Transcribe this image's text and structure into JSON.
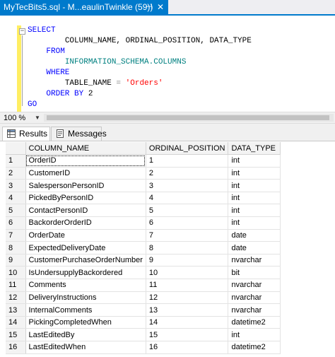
{
  "tab": {
    "title": "MyTecBits5.sql - M...eaulinTwinkle (59))",
    "pin": "⊣",
    "close": "✕"
  },
  "editor": {
    "collapse_glyph": "−",
    "line1_kw": "SELECT",
    "line2": "COLUMN_NAME, ORDINAL_POSITION, DATA_TYPE",
    "line3_kw": "FROM",
    "line4": "INFORMATION_SCHEMA.COLUMNS",
    "line5_kw": "WHERE",
    "line6_a": "TABLE_NAME",
    "line6_op": " = ",
    "line6_str": "'Orders'",
    "line7_kw": "ORDER BY",
    "line7_num": " 2",
    "go": "GO"
  },
  "zoom": {
    "value": "100 %",
    "arrow": "▼"
  },
  "result_tabs": {
    "results": "Results",
    "messages": "Messages"
  },
  "grid": {
    "columns": [
      "",
      "COLUMN_NAME",
      "ORDINAL_POSITION",
      "DATA_TYPE"
    ],
    "rows": [
      [
        "1",
        "OrderID",
        "1",
        "int"
      ],
      [
        "2",
        "CustomerID",
        "2",
        "int"
      ],
      [
        "3",
        "SalespersonPersonID",
        "3",
        "int"
      ],
      [
        "4",
        "PickedByPersonID",
        "4",
        "int"
      ],
      [
        "5",
        "ContactPersonID",
        "5",
        "int"
      ],
      [
        "6",
        "BackorderOrderID",
        "6",
        "int"
      ],
      [
        "7",
        "OrderDate",
        "7",
        "date"
      ],
      [
        "8",
        "ExpectedDeliveryDate",
        "8",
        "date"
      ],
      [
        "9",
        "CustomerPurchaseOrderNumber",
        "9",
        "nvarchar"
      ],
      [
        "10",
        "IsUndersupplyBackordered",
        "10",
        "bit"
      ],
      [
        "11",
        "Comments",
        "11",
        "nvarchar"
      ],
      [
        "12",
        "DeliveryInstructions",
        "12",
        "nvarchar"
      ],
      [
        "13",
        "InternalComments",
        "13",
        "nvarchar"
      ],
      [
        "14",
        "PickingCompletedWhen",
        "14",
        "datetime2"
      ],
      [
        "15",
        "LastEditedBy",
        "15",
        "int"
      ],
      [
        "16",
        "LastEditedWhen",
        "16",
        "datetime2"
      ]
    ]
  },
  "colors": {
    "accent": "#007acc",
    "keyword": "#0000ff",
    "string": "#ff0000",
    "identifier": "#008080",
    "change_bar": "#ffee62"
  }
}
